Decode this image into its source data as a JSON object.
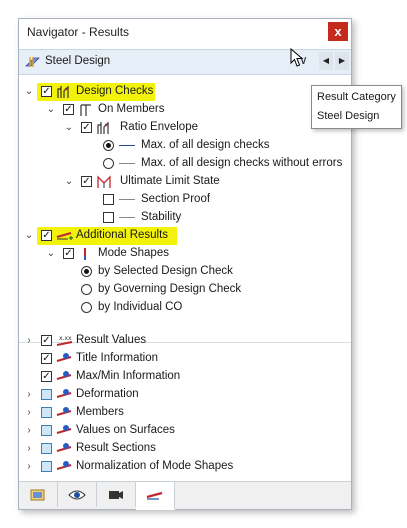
{
  "window": {
    "title": "Navigator - Results",
    "close_glyph": "x"
  },
  "dropdown": {
    "selected": "Steel Design",
    "chevron": "∨",
    "left_arrow": "◀",
    "right_arrow": "▶"
  },
  "tree": {
    "design_checks": "Design Checks",
    "on_members": "On Members",
    "ratio_envelope": "Ratio Envelope",
    "max_all": "Max. of all design checks",
    "max_all_without_errors": "Max. of all design checks without errors",
    "uls": "Ultimate Limit State",
    "section_proof": "Section Proof",
    "stability": "Stability",
    "additional_results": "Additional Results",
    "mode_shapes": "Mode Shapes",
    "by_selected": "by Selected Design Check",
    "by_governing": "by Governing Design Check",
    "by_individual": "by Individual CO"
  },
  "lower": {
    "result_values": "Result Values",
    "title_information": "Title Information",
    "maxmin_information": "Max/Min Information",
    "deformation": "Deformation",
    "members": "Members",
    "values_on_surfaces": "Values on Surfaces",
    "result_sections": "Result Sections",
    "normalization": "Normalization of Mode Shapes"
  },
  "tooltip": {
    "line1": "Result Category",
    "line2": "Steel Design"
  },
  "tabs": [
    "data-icon",
    "eye-icon",
    "camera-icon",
    "results-icon"
  ],
  "colors": {
    "highlight": "#f2f20a",
    "close": "#c42b1c",
    "accent_blue": "#1f4e9e",
    "icon_red": "#c0282e"
  }
}
